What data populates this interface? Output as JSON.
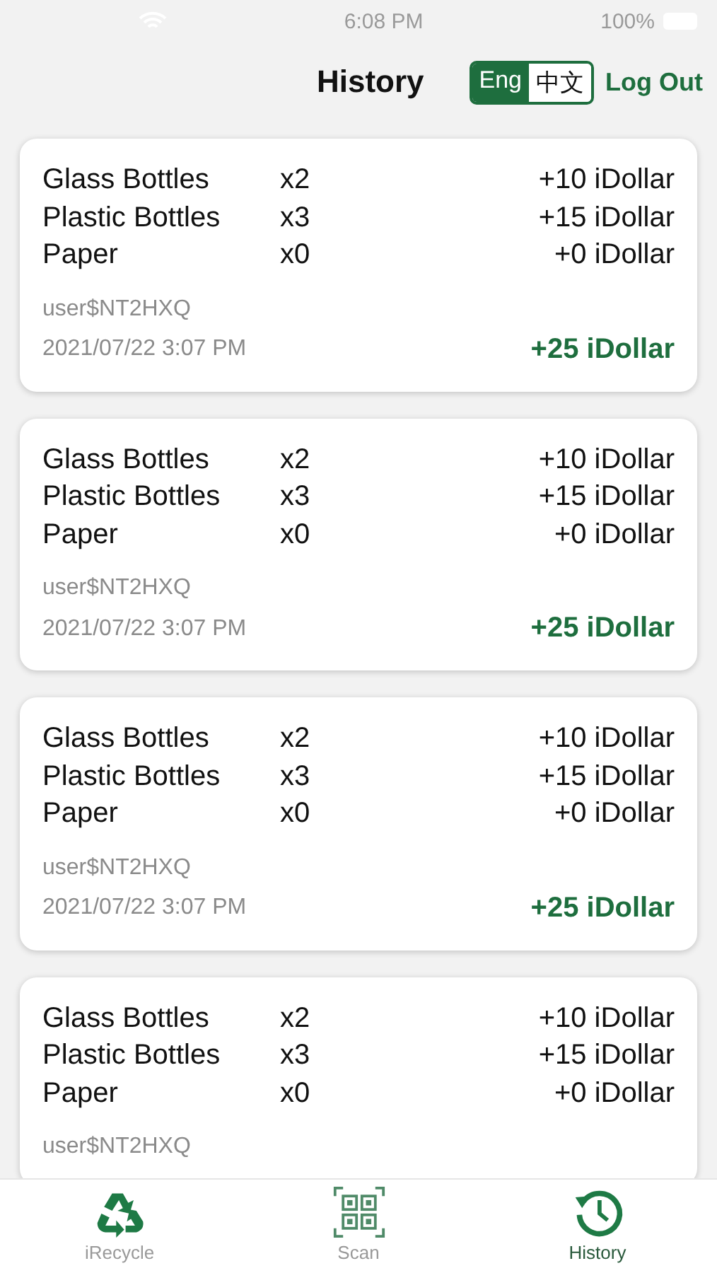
{
  "status_bar": {
    "time": "6:08 PM",
    "battery": "100%"
  },
  "header": {
    "title": "History",
    "languages": [
      {
        "label": "Eng",
        "selected": true
      },
      {
        "label": "中文",
        "selected": false
      }
    ],
    "logout": "Log Out"
  },
  "records": [
    {
      "items": [
        {
          "name": "Glass Bottles",
          "qty": "x2",
          "amount": "+10 iDollar"
        },
        {
          "name": "Plastic Bottles",
          "qty": "x3",
          "amount": "+15 iDollar"
        },
        {
          "name": "Paper",
          "qty": "x0",
          "amount": "+0 iDollar"
        }
      ],
      "user": "user$NT2HXQ",
      "date": "2021/07/22 3:07 PM",
      "total": "+25 iDollar"
    },
    {
      "items": [
        {
          "name": "Glass Bottles",
          "qty": "x2",
          "amount": "+10 iDollar"
        },
        {
          "name": "Plastic Bottles",
          "qty": "x3",
          "amount": "+15 iDollar"
        },
        {
          "name": "Paper",
          "qty": "x0",
          "amount": "+0 iDollar"
        }
      ],
      "user": "user$NT2HXQ",
      "date": "2021/07/22 3:07 PM",
      "total": "+25 iDollar"
    },
    {
      "items": [
        {
          "name": "Glass Bottles",
          "qty": "x2",
          "amount": "+10 iDollar"
        },
        {
          "name": "Plastic Bottles",
          "qty": "x3",
          "amount": "+15 iDollar"
        },
        {
          "name": "Paper",
          "qty": "x0",
          "amount": "+0 iDollar"
        }
      ],
      "user": "user$NT2HXQ",
      "date": "2021/07/22 3:07 PM",
      "total": "+25 iDollar"
    },
    {
      "items": [
        {
          "name": "Glass Bottles",
          "qty": "x2",
          "amount": "+10 iDollar"
        },
        {
          "name": "Plastic Bottles",
          "qty": "x3",
          "amount": "+15 iDollar"
        },
        {
          "name": "Paper",
          "qty": "x0",
          "amount": "+0 iDollar"
        }
      ],
      "user": "user$NT2HXQ"
    }
  ],
  "tab_bar": [
    {
      "kind": "recycle",
      "label": "iRecycle",
      "selected": false
    },
    {
      "kind": "scan",
      "label": "Scan",
      "selected": false
    },
    {
      "kind": "history",
      "label": "History",
      "selected": true
    }
  ]
}
